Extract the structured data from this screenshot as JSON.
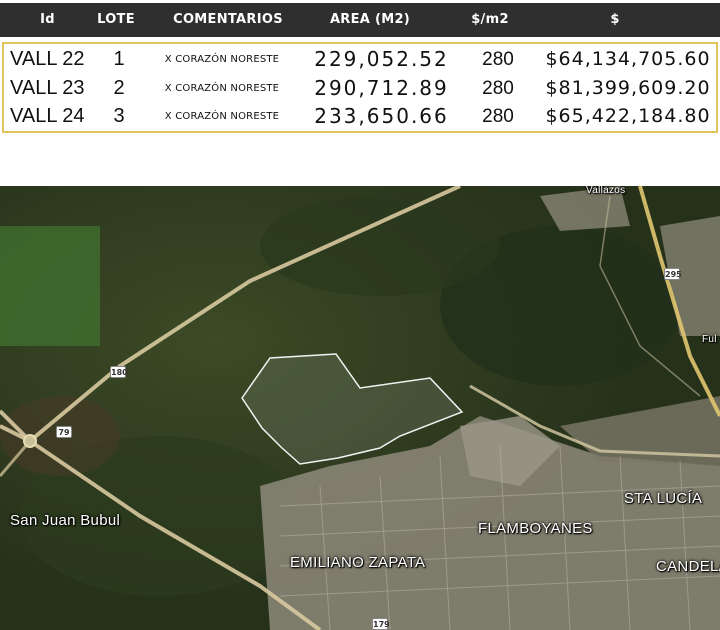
{
  "table": {
    "headers": {
      "id": "Id",
      "lote": "LOTE",
      "comentarios": "COMENTARIOS",
      "area": "AREA (M2)",
      "price_m2": "$/m2",
      "total": "$"
    },
    "rows": [
      {
        "id": "VALL 22",
        "lote": "1",
        "comentarios": "X CORAZÓN NORESTE",
        "area": "229,052.52",
        "price_m2": "280",
        "total": "$64,134,705.60"
      },
      {
        "id": "VALL 23",
        "lote": "2",
        "comentarios": "X CORAZÓN NORESTE",
        "area": "290,712.89",
        "price_m2": "280",
        "total": "$81,399,609.20"
      },
      {
        "id": "VALL 24",
        "lote": "3",
        "comentarios": "X CORAZÓN NORESTE",
        "area": "233,650.66",
        "price_m2": "280",
        "total": "$65,422,184.80"
      }
    ],
    "colors": {
      "header_bg": "#2f2f2f",
      "border": "#e3c45a"
    }
  },
  "map": {
    "labels": {
      "san_juan_bubul": "San Juan Bubul",
      "flamboyanes": "FLAMBOYANES",
      "emiliano_zapata": "EMILIANO ZAPATA",
      "sta_lucia": "STA LUCÍA",
      "candela": "CANDELA",
      "vallazos": "Vallazos",
      "ful": "Ful"
    },
    "road_shields": {
      "r180": "180",
      "r79": "79",
      "r295": "295",
      "r179": "179"
    }
  }
}
